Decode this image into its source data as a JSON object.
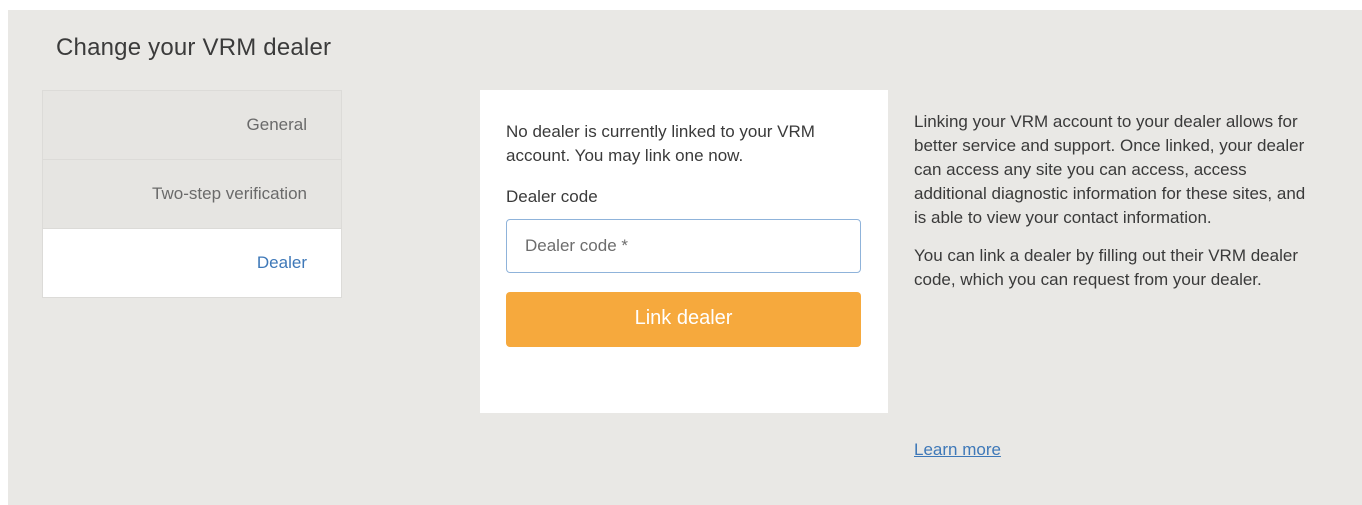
{
  "page": {
    "title": "Change your VRM dealer"
  },
  "sidenav": {
    "items": [
      {
        "label": "General",
        "active": false
      },
      {
        "label": "Two-step verification",
        "active": false
      },
      {
        "label": "Dealer",
        "active": true
      }
    ]
  },
  "dealer_card": {
    "message": "No dealer is currently linked to your VRM account. You may link one now.",
    "field_label": "Dealer code",
    "input_value": "",
    "input_placeholder": "Dealer code *",
    "button_label": "Link dealer"
  },
  "info": {
    "paragraph_1": "Linking your VRM account to your dealer allows for better service and support. Once linked, your dealer can access any site you can access, access additional diagnostic information for these sites, and is able to view your contact information.",
    "paragraph_2": "You can link a dealer by filling out their VRM dealer code, which you can request from your dealer.",
    "learn_more": "Learn more"
  },
  "colors": {
    "background": "#e9e8e5",
    "accent_link": "#3e78b8",
    "button": "#f6a93d",
    "input_border": "#8fb3da"
  }
}
